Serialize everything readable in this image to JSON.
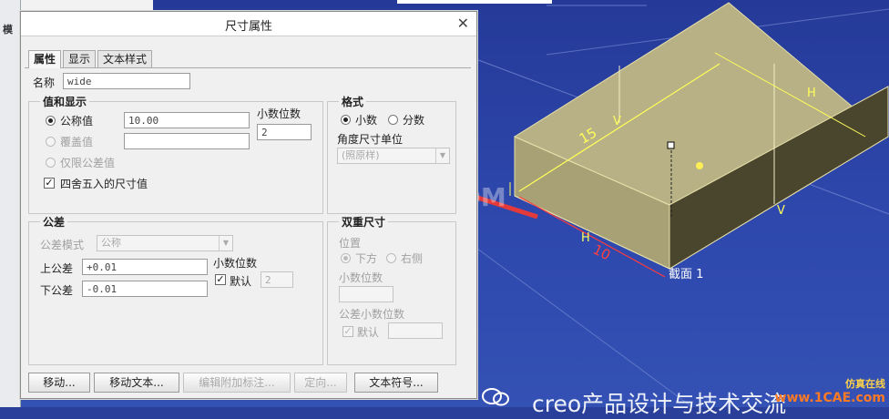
{
  "dialog": {
    "title": "尺寸属性",
    "tabs": [
      "属性",
      "显示",
      "文本样式"
    ],
    "name_label": "名称",
    "name_value": "wide"
  },
  "value_group": {
    "title": "值和显示",
    "nominal_label": "公称值",
    "nominal_value": "10.00",
    "override_label": "覆盖值",
    "tol_only_label": "仅限公差值",
    "round_label": "四舍五入的尺寸值",
    "decimals_label": "小数位数",
    "decimals_value": "2"
  },
  "format_group": {
    "title": "格式",
    "decimal_label": "小数",
    "fraction_label": "分数",
    "angle_unit_label": "角度尺寸单位",
    "angle_unit_value": "(照原样)"
  },
  "tolerance_group": {
    "title": "公差",
    "mode_label": "公差模式",
    "mode_value": "公称",
    "upper_label": "上公差",
    "upper_value": "+0.01",
    "lower_label": "下公差",
    "lower_value": "-0.01",
    "decimals_label": "小数位数",
    "default_label": "默认",
    "decimals_value": "2"
  },
  "dual_group": {
    "title": "双重尺寸",
    "position_label": "位置",
    "below_label": "下方",
    "right_label": "右侧",
    "decimals_label": "小数位数",
    "tol_decimals_label": "公差小数位数",
    "default_label": "默认"
  },
  "buttons": {
    "move": "移动...",
    "move_text": "移动文本...",
    "edit_attached": "编辑附加标注...",
    "orient": "定向...",
    "text_symbol": "文本符号..."
  },
  "model": {
    "dim_15": "15",
    "dim_10": "10",
    "label_h": "H",
    "label_v": "V",
    "section_label": "截面 1"
  },
  "left_panel": {
    "title": "模"
  },
  "watermark": "1CAE.COM",
  "footer_text": "creo产品设计与技术交流",
  "logo": {
    "top": "仿真在线",
    "bottom": "www.1CAE.com"
  },
  "colors": {
    "viewport": "#2e48ad",
    "arrow": "#e53a3a",
    "model_top": "#b8b185",
    "model_side": "#4a462e",
    "dim_line": "#ffff5a"
  }
}
